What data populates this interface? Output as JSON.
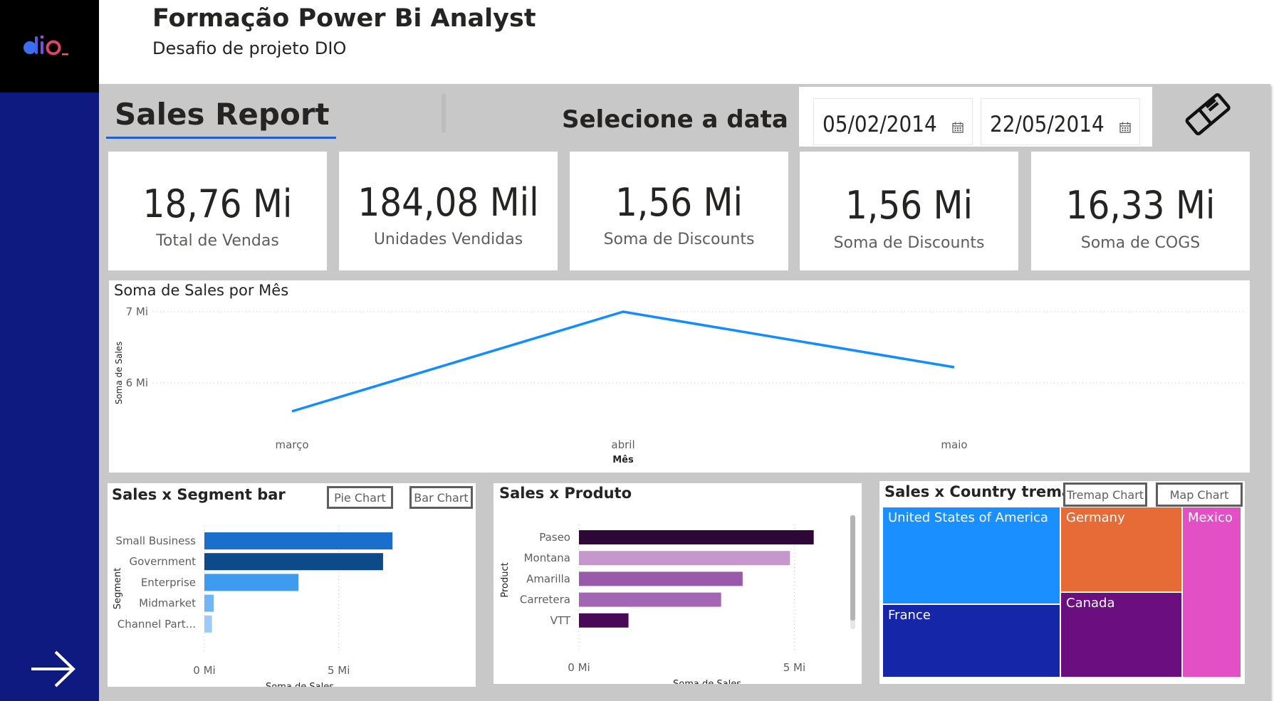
{
  "header": {
    "title": "Formação Power Bi Analyst",
    "subtitle": "Desafio de projeto DIO",
    "logo_text": "dio_"
  },
  "report": {
    "title": "Sales Report",
    "date_label": "Selecione a data",
    "date_start": "05/02/2014",
    "date_end": "22/05/2014"
  },
  "kpis": [
    {
      "value": "18,76 Mi",
      "label": "Total de Vendas"
    },
    {
      "value": "184,08 Mil",
      "label": "Unidades Vendidas"
    },
    {
      "value": "1,56 Mi",
      "label": "Soma de Discounts"
    },
    {
      "value": "1,56 Mi",
      "label": "Soma de Discounts"
    },
    {
      "value": "16,33 Mi",
      "label": "Soma de COGS"
    }
  ],
  "line_panel": {
    "title": "Soma de Sales por Mês"
  },
  "segment_panel": {
    "title": "Sales x Segment bar",
    "toggle_pie": "Pie Chart",
    "toggle_bar": "Bar Chart"
  },
  "product_panel": {
    "title": "Sales x Produto"
  },
  "country_panel": {
    "title": "Sales x Country tremap",
    "toggle_treemap": "Tremap Chart",
    "toggle_map": "Map Chart"
  },
  "colors": {
    "accent": "#1f5fd3",
    "rail": "#0f1a80",
    "line": "#118dff"
  },
  "chart_data": [
    {
      "type": "line",
      "title": "Soma de Sales por Mês",
      "xlabel": "Mês",
      "ylabel": "Soma de Sales",
      "categories": [
        "março",
        "abril",
        "maio"
      ],
      "values": [
        5.6,
        7.0,
        6.22
      ],
      "ylim": [
        5.4,
        7.0
      ],
      "y_ticks": [
        6,
        7
      ],
      "y_tick_labels": [
        "6 Mi",
        "7 Mi"
      ],
      "grid": true
    },
    {
      "type": "bar",
      "orientation": "horizontal",
      "title": "Sales x Segment bar",
      "xlabel": "Soma de Sales",
      "ylabel": "Segment",
      "categories": [
        "Small Business",
        "Government",
        "Enterprise",
        "Midmarket",
        "Channel Part..."
      ],
      "values": [
        7.0,
        6.65,
        3.5,
        0.35,
        0.28
      ],
      "bar_colors": [
        "#1a6fcc",
        "#0c4a8a",
        "#3d9bf0",
        "#6fb6f6",
        "#9ccaf9"
      ],
      "xlim": [
        0,
        7.5
      ],
      "x_ticks": [
        0,
        5
      ],
      "x_tick_labels": [
        "0 Mi",
        "5 Mi"
      ]
    },
    {
      "type": "bar",
      "orientation": "horizontal",
      "title": "Sales x Produto",
      "xlabel": "Soma de Sales",
      "ylabel": "Product",
      "categories": [
        "Paseo",
        "Montana",
        "Amarilla",
        "Carretera",
        "VTT"
      ],
      "values": [
        5.45,
        4.9,
        3.8,
        3.3,
        1.15
      ],
      "bar_colors": [
        "#2e0638",
        "#c597cd",
        "#9a5aac",
        "#a366b4",
        "#4a0858"
      ],
      "xlim": [
        0,
        6.2
      ],
      "x_ticks": [
        0,
        5
      ],
      "x_tick_labels": [
        "0 Mi",
        "5 Mi"
      ]
    },
    {
      "type": "treemap",
      "title": "Sales x Country tremap",
      "categories": [
        "United States of America",
        "France",
        "Germany",
        "Canada",
        "Mexico"
      ],
      "colors": [
        "#1a8fff",
        "#1626a8",
        "#e76b37",
        "#6b0f80",
        "#e34fc4"
      ]
    }
  ]
}
